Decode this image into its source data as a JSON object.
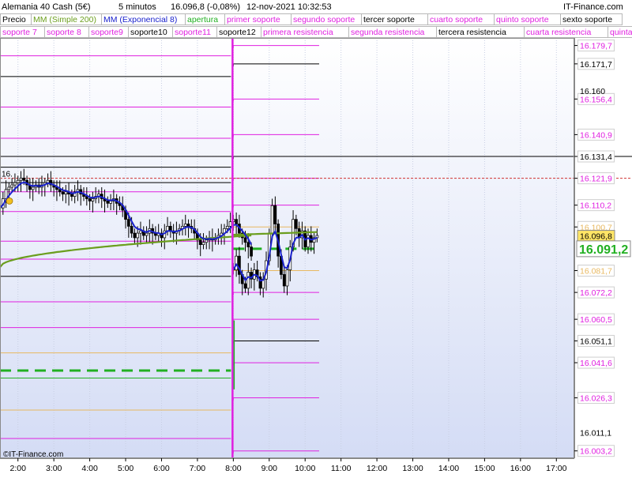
{
  "header": {
    "instrument": "Alemania 40 Cash (5€)",
    "timeframe": "5 minutos",
    "last_change": "16.096,8 (-0,08%)",
    "datetime": "12-nov-2021 10:32:53",
    "brand": "IT-Finance.com"
  },
  "legend_row1": [
    {
      "label": "Precio",
      "color": "#000000"
    },
    {
      "label": "MM (Simple 200)",
      "color": "#6b9e1e"
    },
    {
      "label": "MM (Exponencial 8)",
      "color": "#1a22cc"
    },
    {
      "label": "apertura",
      "color": "#22b022"
    },
    {
      "label": "primer soporte",
      "color": "#e020e0"
    },
    {
      "label": "segundo soporte",
      "color": "#e020e0"
    },
    {
      "label": "tercer soporte",
      "color": "#000000"
    },
    {
      "label": "cuarto soporte",
      "color": "#e020e0"
    },
    {
      "label": "quinto soporte",
      "color": "#e020e0"
    },
    {
      "label": "sexto soporte",
      "color": "#000000"
    }
  ],
  "legend_row2": [
    {
      "label": "soporte 7",
      "color": "#e020e0"
    },
    {
      "label": "soporte 8",
      "color": "#e020e0"
    },
    {
      "label": "soporte9",
      "color": "#e020e0"
    },
    {
      "label": "soporte10",
      "color": "#000000"
    },
    {
      "label": "soporte11",
      "color": "#e020e0"
    },
    {
      "label": "soporte12",
      "color": "#000000"
    },
    {
      "label": "primera resistencia",
      "color": "#e020e0"
    },
    {
      "label": "segunda resistencia",
      "color": "#e020e0"
    },
    {
      "label": "tercera resistencia",
      "color": "#000000"
    },
    {
      "label": "cuarta resistencia",
      "color": "#e020e0"
    },
    {
      "label": "quinta resistencia",
      "color": "#e020e0"
    }
  ],
  "copyright": "©IT-Finance.com",
  "colors": {
    "magenta": "#e020e0",
    "black": "#000000",
    "green": "#22b022",
    "orange": "#e8b860",
    "blue": "#1a22cc",
    "olive": "#6b9e1e",
    "red": "#d03030"
  },
  "chart_data": {
    "type": "candlestick",
    "x_ticks": [
      "2:00",
      "3:00",
      "4:00",
      "5:00",
      "6:00",
      "7:00",
      "8:00",
      "9:00",
      "10:00",
      "11:00",
      "12:00",
      "13:00",
      "14:00",
      "15:00",
      "16:00",
      "17:00"
    ],
    "x_range": [
      "1:30",
      "17:30"
    ],
    "y_range": [
      16000.0,
      16183.0
    ],
    "y_ticks": [
      16160,
      16011.1
    ],
    "last_price": {
      "value": 16096.8,
      "label": "16.096,8"
    },
    "opening": {
      "value": 16091.2,
      "label": "16.091,2"
    },
    "levels": [
      {
        "value": 16179.7,
        "label": "16.179,7",
        "color": "#e020e0"
      },
      {
        "value": 16171.7,
        "label": "16.171,7",
        "color": "#000000"
      },
      {
        "value": 16156.4,
        "label": "16.156,4",
        "color": "#e020e0"
      },
      {
        "value": 16140.9,
        "label": "16.140,9",
        "color": "#e020e0"
      },
      {
        "value": 16131.4,
        "label": "16.131,4",
        "color": "#000000"
      },
      {
        "value": 16121.9,
        "label": "16.121,9",
        "color": "#e020e0"
      },
      {
        "value": 16110.2,
        "label": "16.110,2",
        "color": "#e020e0"
      },
      {
        "value": 16100.7,
        "label": "16.100,7",
        "color": "#e8b860"
      },
      {
        "value": 16081.7,
        "label": "16.081,7",
        "color": "#e8b860"
      },
      {
        "value": 16072.2,
        "label": "16.072,2",
        "color": "#e020e0"
      },
      {
        "value": 16060.5,
        "label": "16.060,5",
        "color": "#e020e0"
      },
      {
        "value": 16051.1,
        "label": "16.051,1",
        "color": "#000000"
      },
      {
        "value": 16041.6,
        "label": "16.041,6",
        "color": "#e020e0"
      },
      {
        "value": 16026.3,
        "label": "16.026,3",
        "color": "#e020e0"
      },
      {
        "value": 16003.2,
        "label": "16.003,2",
        "color": "#e020e0"
      }
    ],
    "previous_levels": [
      16175.2,
      16166.2,
      16152.9,
      16139.3,
      16126.7,
      16116.0,
      16107.4,
      16094.5,
      16086.7,
      16079.2,
      16068.1,
      16056.9,
      16045.9,
      16034.9,
      16021.0,
      16008.6
    ],
    "previous_level_colors": [
      "#e020e0",
      "#000000",
      "#e020e0",
      "#e020e0",
      "#000000",
      "#e020e0",
      "#e020e0",
      "#e020e0",
      "#e020e0",
      "#000000",
      "#e020e0",
      "#e020e0",
      "#e8b860",
      "#22b022",
      "#e8b860",
      "#e020e0"
    ],
    "previous_opening": 16038.2,
    "candles_prev": {
      "start": "1:30",
      "interval_min": 5,
      "close": [
        16109,
        16113,
        16117,
        16118,
        16119,
        16120,
        16121,
        16122,
        16121,
        16119,
        16117,
        16118,
        16119,
        16118,
        16119,
        16120,
        16121,
        16119,
        16118,
        16117,
        16116,
        16115,
        16116,
        16115,
        16114,
        16116,
        16117,
        16115,
        16114,
        16113,
        16112,
        16113,
        16114,
        16115,
        16113,
        16112,
        16111,
        16112,
        16113,
        16111,
        16110,
        16108,
        16104,
        16101,
        16098,
        16096,
        16098,
        16099,
        16097,
        16098,
        16100,
        16098,
        16097,
        16098,
        16096,
        16099,
        16101,
        16099,
        16098,
        16099,
        16100,
        16101,
        16102,
        16101,
        16100,
        16098,
        16095,
        16093,
        16094,
        16095,
        16096,
        16095,
        16096,
        16097,
        16098,
        16100,
        16101,
        16103,
        16104,
        16102,
        16098,
        16096,
        16094,
        16092,
        16088
      ]
    },
    "candles_today": {
      "start": "8:00",
      "interval_min": 5,
      "close": [
        16082,
        16088,
        16080,
        16076,
        16074,
        16081,
        16078,
        16082,
        16079,
        16074,
        16078,
        16086,
        16098,
        16110,
        16102,
        16088,
        16080,
        16075,
        16082,
        16092,
        16104,
        16100,
        16096,
        16099,
        16092,
        16097,
        16094,
        16096,
        16097
      ]
    },
    "sma200_endpoint": 16098.5,
    "sma200_start": 16083.2
  }
}
